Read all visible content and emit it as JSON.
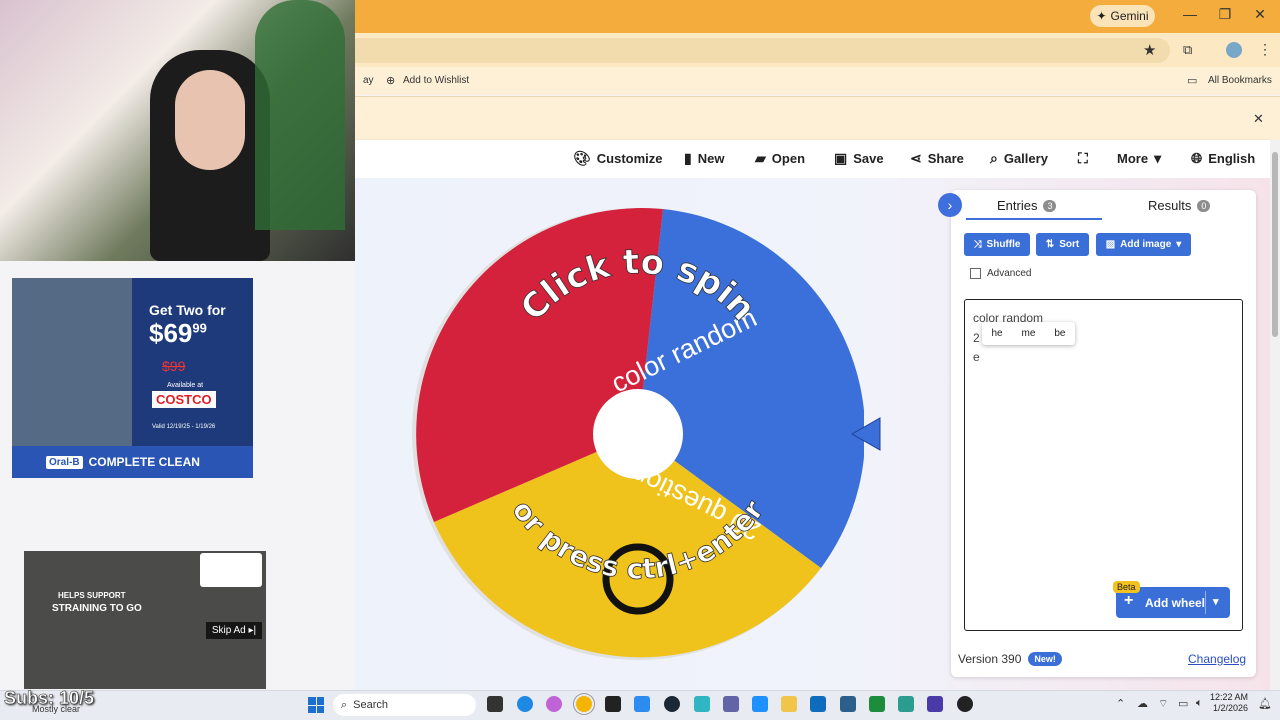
{
  "browser": {
    "gemini_label": "Gemini",
    "bookmarks": {
      "partial_item": "ay",
      "wishlist": "Add to Wishlist",
      "all_bookmarks": "All Bookmarks"
    },
    "close_infobar": "✕"
  },
  "toolbar": {
    "customize": "Customize",
    "new": "New",
    "open": "Open",
    "save": "Save",
    "share": "Share",
    "gallery": "Gallery",
    "more": "More",
    "language": "English"
  },
  "wheel": {
    "segments": [
      {
        "label": "20 questions",
        "color": "#d4213c"
      },
      {
        "label": "color random",
        "color": "#3b6fd9"
      },
      {
        "label": "",
        "color": "#f0c21c"
      }
    ],
    "overlay_top": "Click to spin",
    "overlay_bottom": "or press ctrl+enter"
  },
  "panel": {
    "tabs": [
      {
        "label": "Entries",
        "count": "3"
      },
      {
        "label": "Results",
        "count": "0"
      }
    ],
    "buttons": {
      "shuffle": "Shuffle",
      "sort": "Sort",
      "add_image": "Add image"
    },
    "advanced_label": "Advanced",
    "entries_text": [
      "color random",
      "2",
      "e"
    ],
    "suggestions": [
      "he",
      "me",
      "be"
    ],
    "add_wheel": "Add wheel",
    "beta": "Beta",
    "version": "Version 390",
    "new_badge": "New!",
    "changelog": "Changelog"
  },
  "overlays": {
    "ad1": {
      "headline": "Get Two for",
      "price": "$69",
      "price_cents": "99",
      "old_price": "$99",
      "store": "COSTCO",
      "available": "Available at",
      "valid": "Valid 12/19/25 - 1/19/26",
      "brand_strip": "COMPLETE CLEAN",
      "brand_logo": "Oral-B"
    },
    "ad2": {
      "headline": "HELPS SUPPORT",
      "headline2": "STRAINING TO GO",
      "skip": "Skip Ad"
    },
    "subs": "Subs: 10/5"
  },
  "taskbar": {
    "search": "Search",
    "weather": "Mostly clear",
    "time": "12:22 AM",
    "date": "1/2/2026"
  }
}
